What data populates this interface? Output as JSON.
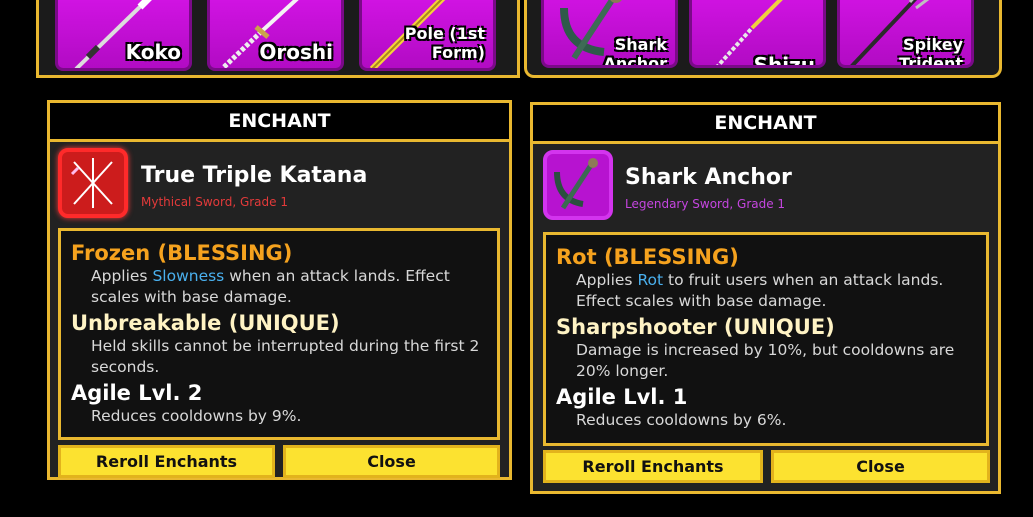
{
  "inventory": {
    "left_slots": [
      {
        "label": "Koko",
        "icon": "spear-icon"
      },
      {
        "label": "Oroshi",
        "icon": "katana-icon"
      },
      {
        "label": "Pole (1st\nForm)",
        "icon": "pole-icon"
      }
    ],
    "right_slots": [
      {
        "label": "Shark\nAnchor",
        "icon": "anchor-icon"
      },
      {
        "label": "Shizu",
        "icon": "katana-icon"
      },
      {
        "label": "Spikey\nTrident",
        "icon": "trident-icon"
      }
    ]
  },
  "panels": [
    {
      "title": "ENCHANT",
      "item_name": "True Triple Katana",
      "item_subtitle": "Mythical Sword, Grade 1",
      "icon": "triple-katana-icon",
      "enchants": [
        {
          "name": "Frozen (BLESSING)",
          "desc_pre": "Applies ",
          "desc_keyword": "Slowness",
          "desc_post": " when an attack lands. Effect scales with base damage."
        },
        {
          "name": "Unbreakable (UNIQUE)",
          "desc": "Held skills cannot be interrupted during the first 2 seconds."
        },
        {
          "name": "Agile Lvl. 2",
          "desc": "Reduces cooldowns by 9%."
        }
      ],
      "reroll_label": "Reroll Enchants",
      "close_label": "Close"
    },
    {
      "title": "ENCHANT",
      "item_name": "Shark Anchor",
      "item_subtitle": "Legendary Sword, Grade 1",
      "icon": "shark-anchor-icon",
      "enchants": [
        {
          "name": "Rot (BLESSING)",
          "desc_pre": "Applies ",
          "desc_keyword": "Rot",
          "desc_post": " to fruit users when an attack lands. Effect scales with base damage."
        },
        {
          "name": "Sharpshooter (UNIQUE)",
          "desc": "Damage is increased by 10%, but cooldowns are 20% longer."
        },
        {
          "name": "Agile Lvl. 1",
          "desc": "Reduces cooldowns by 6%."
        }
      ],
      "reroll_label": "Reroll Enchants",
      "close_label": "Close"
    }
  ],
  "colors": {
    "gold_border": "#e9b830",
    "slot_purple": "#d414e6",
    "blessing_orange": "#f5a21e",
    "keyword_blue": "#4ab0ee",
    "button_yellow": "#fce230"
  }
}
